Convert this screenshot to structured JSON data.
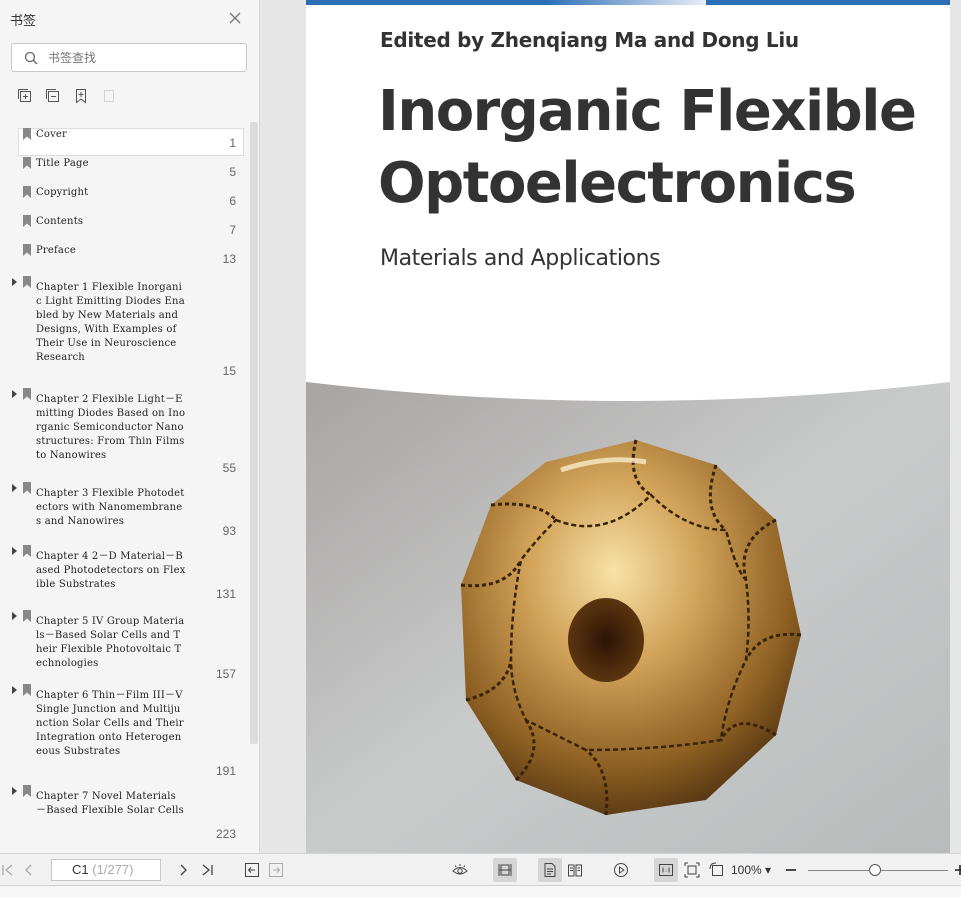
{
  "sidebar": {
    "title": "书签",
    "search_placeholder": "书签查找",
    "items": [
      {
        "label": "Cover",
        "page": "1",
        "expandable": false
      },
      {
        "label": "Title Page",
        "page": "5",
        "expandable": false
      },
      {
        "label": "Copyright",
        "page": "6",
        "expandable": false
      },
      {
        "label": "Contents",
        "page": "7",
        "expandable": false
      },
      {
        "label": "Preface",
        "page": "13",
        "expandable": false
      },
      {
        "label": "Chapter 1 Flexible Inorganic Light Emitting Diodes Enabled by New Materials and Designs, With Examples of Their Use in Neuroscience Research",
        "page": "15",
        "expandable": true
      },
      {
        "label": "Chapter 2 Flexible Light－Emitting Diodes Based on Inorganic Semiconductor Nanostructures: From Thin Films to Nanowires",
        "page": "55",
        "expandable": true
      },
      {
        "label": "Chapter 3 Flexible Photodetectors with Nanomembranes and Nanowires",
        "page": "93",
        "expandable": true
      },
      {
        "label": "Chapter 4 2－D Material－Based Photodetectors on Flexible Substrates",
        "page": "131",
        "expandable": true
      },
      {
        "label": "Chapter 5 IV Group Materials－Based Solar Cells and Their Flexible Photovoltaic Technologies",
        "page": "157",
        "expandable": true
      },
      {
        "label": "Chapter 6 Thin－Film III－V Single Junction and Multijunction Solar Cells and Their Integration onto Heterogeneous Substrates",
        "page": "191",
        "expandable": true
      },
      {
        "label": "Chapter 7 Novel Materials－Based Flexible Solar Cells",
        "page": "223",
        "expandable": true
      }
    ]
  },
  "document": {
    "editors": "Edited by Zhenqiang Ma and Dong Liu",
    "title_line1": "Inorganic Flexible",
    "title_line2": "Optoelectronics",
    "subtitle": "Materials and Applications"
  },
  "statusbar": {
    "current_page": "C1",
    "page_total": " (1/277)",
    "zoom": "100%"
  },
  "colors": {
    "accent_bar": "#2c6fb7",
    "sidebar_bg": "#f5f5f5"
  }
}
